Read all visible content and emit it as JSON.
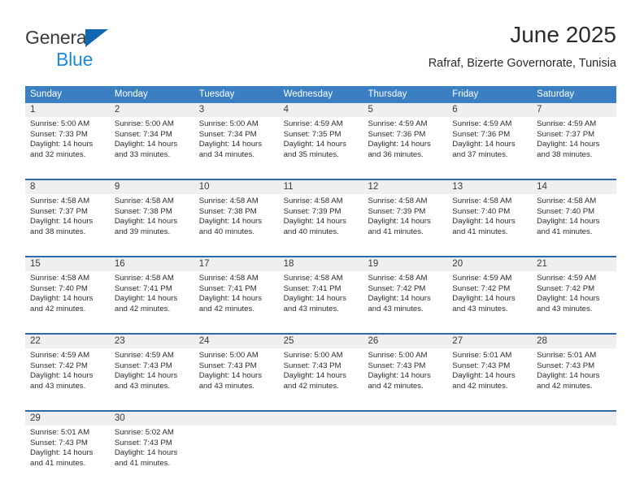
{
  "brand": {
    "name_part1": "General",
    "name_part2": "Blue",
    "logo_icon": "triangle-logo-icon",
    "accent_dark": "#1267b2",
    "accent_light": "#1e8ad6"
  },
  "header": {
    "title": "June 2025",
    "subtitle": "Rafraf, Bizerte Governorate, Tunisia"
  },
  "colors": {
    "header_row_bg": "#3a7fc1",
    "week_divider": "#2c6aa8",
    "daynum_strip_bg": "#efefef",
    "text": "#2d2d2d"
  },
  "calendar": {
    "weekdays": [
      "Sunday",
      "Monday",
      "Tuesday",
      "Wednesday",
      "Thursday",
      "Friday",
      "Saturday"
    ],
    "weeks": [
      [
        {
          "day": "1",
          "sunrise": "Sunrise: 5:00 AM",
          "sunset": "Sunset: 7:33 PM",
          "daylight_line1": "Daylight: 14 hours",
          "daylight_line2": "and 32 minutes."
        },
        {
          "day": "2",
          "sunrise": "Sunrise: 5:00 AM",
          "sunset": "Sunset: 7:34 PM",
          "daylight_line1": "Daylight: 14 hours",
          "daylight_line2": "and 33 minutes."
        },
        {
          "day": "3",
          "sunrise": "Sunrise: 5:00 AM",
          "sunset": "Sunset: 7:34 PM",
          "daylight_line1": "Daylight: 14 hours",
          "daylight_line2": "and 34 minutes."
        },
        {
          "day": "4",
          "sunrise": "Sunrise: 4:59 AM",
          "sunset": "Sunset: 7:35 PM",
          "daylight_line1": "Daylight: 14 hours",
          "daylight_line2": "and 35 minutes."
        },
        {
          "day": "5",
          "sunrise": "Sunrise: 4:59 AM",
          "sunset": "Sunset: 7:36 PM",
          "daylight_line1": "Daylight: 14 hours",
          "daylight_line2": "and 36 minutes."
        },
        {
          "day": "6",
          "sunrise": "Sunrise: 4:59 AM",
          "sunset": "Sunset: 7:36 PM",
          "daylight_line1": "Daylight: 14 hours",
          "daylight_line2": "and 37 minutes."
        },
        {
          "day": "7",
          "sunrise": "Sunrise: 4:59 AM",
          "sunset": "Sunset: 7:37 PM",
          "daylight_line1": "Daylight: 14 hours",
          "daylight_line2": "and 38 minutes."
        }
      ],
      [
        {
          "day": "8",
          "sunrise": "Sunrise: 4:58 AM",
          "sunset": "Sunset: 7:37 PM",
          "daylight_line1": "Daylight: 14 hours",
          "daylight_line2": "and 38 minutes."
        },
        {
          "day": "9",
          "sunrise": "Sunrise: 4:58 AM",
          "sunset": "Sunset: 7:38 PM",
          "daylight_line1": "Daylight: 14 hours",
          "daylight_line2": "and 39 minutes."
        },
        {
          "day": "10",
          "sunrise": "Sunrise: 4:58 AM",
          "sunset": "Sunset: 7:38 PM",
          "daylight_line1": "Daylight: 14 hours",
          "daylight_line2": "and 40 minutes."
        },
        {
          "day": "11",
          "sunrise": "Sunrise: 4:58 AM",
          "sunset": "Sunset: 7:39 PM",
          "daylight_line1": "Daylight: 14 hours",
          "daylight_line2": "and 40 minutes."
        },
        {
          "day": "12",
          "sunrise": "Sunrise: 4:58 AM",
          "sunset": "Sunset: 7:39 PM",
          "daylight_line1": "Daylight: 14 hours",
          "daylight_line2": "and 41 minutes."
        },
        {
          "day": "13",
          "sunrise": "Sunrise: 4:58 AM",
          "sunset": "Sunset: 7:40 PM",
          "daylight_line1": "Daylight: 14 hours",
          "daylight_line2": "and 41 minutes."
        },
        {
          "day": "14",
          "sunrise": "Sunrise: 4:58 AM",
          "sunset": "Sunset: 7:40 PM",
          "daylight_line1": "Daylight: 14 hours",
          "daylight_line2": "and 41 minutes."
        }
      ],
      [
        {
          "day": "15",
          "sunrise": "Sunrise: 4:58 AM",
          "sunset": "Sunset: 7:40 PM",
          "daylight_line1": "Daylight: 14 hours",
          "daylight_line2": "and 42 minutes."
        },
        {
          "day": "16",
          "sunrise": "Sunrise: 4:58 AM",
          "sunset": "Sunset: 7:41 PM",
          "daylight_line1": "Daylight: 14 hours",
          "daylight_line2": "and 42 minutes."
        },
        {
          "day": "17",
          "sunrise": "Sunrise: 4:58 AM",
          "sunset": "Sunset: 7:41 PM",
          "daylight_line1": "Daylight: 14 hours",
          "daylight_line2": "and 42 minutes."
        },
        {
          "day": "18",
          "sunrise": "Sunrise: 4:58 AM",
          "sunset": "Sunset: 7:41 PM",
          "daylight_line1": "Daylight: 14 hours",
          "daylight_line2": "and 43 minutes."
        },
        {
          "day": "19",
          "sunrise": "Sunrise: 4:58 AM",
          "sunset": "Sunset: 7:42 PM",
          "daylight_line1": "Daylight: 14 hours",
          "daylight_line2": "and 43 minutes."
        },
        {
          "day": "20",
          "sunrise": "Sunrise: 4:59 AM",
          "sunset": "Sunset: 7:42 PM",
          "daylight_line1": "Daylight: 14 hours",
          "daylight_line2": "and 43 minutes."
        },
        {
          "day": "21",
          "sunrise": "Sunrise: 4:59 AM",
          "sunset": "Sunset: 7:42 PM",
          "daylight_line1": "Daylight: 14 hours",
          "daylight_line2": "and 43 minutes."
        }
      ],
      [
        {
          "day": "22",
          "sunrise": "Sunrise: 4:59 AM",
          "sunset": "Sunset: 7:42 PM",
          "daylight_line1": "Daylight: 14 hours",
          "daylight_line2": "and 43 minutes."
        },
        {
          "day": "23",
          "sunrise": "Sunrise: 4:59 AM",
          "sunset": "Sunset: 7:43 PM",
          "daylight_line1": "Daylight: 14 hours",
          "daylight_line2": "and 43 minutes."
        },
        {
          "day": "24",
          "sunrise": "Sunrise: 5:00 AM",
          "sunset": "Sunset: 7:43 PM",
          "daylight_line1": "Daylight: 14 hours",
          "daylight_line2": "and 43 minutes."
        },
        {
          "day": "25",
          "sunrise": "Sunrise: 5:00 AM",
          "sunset": "Sunset: 7:43 PM",
          "daylight_line1": "Daylight: 14 hours",
          "daylight_line2": "and 42 minutes."
        },
        {
          "day": "26",
          "sunrise": "Sunrise: 5:00 AM",
          "sunset": "Sunset: 7:43 PM",
          "daylight_line1": "Daylight: 14 hours",
          "daylight_line2": "and 42 minutes."
        },
        {
          "day": "27",
          "sunrise": "Sunrise: 5:01 AM",
          "sunset": "Sunset: 7:43 PM",
          "daylight_line1": "Daylight: 14 hours",
          "daylight_line2": "and 42 minutes."
        },
        {
          "day": "28",
          "sunrise": "Sunrise: 5:01 AM",
          "sunset": "Sunset: 7:43 PM",
          "daylight_line1": "Daylight: 14 hours",
          "daylight_line2": "and 42 minutes."
        }
      ],
      [
        {
          "day": "29",
          "sunrise": "Sunrise: 5:01 AM",
          "sunset": "Sunset: 7:43 PM",
          "daylight_line1": "Daylight: 14 hours",
          "daylight_line2": "and 41 minutes."
        },
        {
          "day": "30",
          "sunrise": "Sunrise: 5:02 AM",
          "sunset": "Sunset: 7:43 PM",
          "daylight_line1": "Daylight: 14 hours",
          "daylight_line2": "and 41 minutes."
        },
        {
          "day": "",
          "sunrise": "",
          "sunset": "",
          "daylight_line1": "",
          "daylight_line2": ""
        },
        {
          "day": "",
          "sunrise": "",
          "sunset": "",
          "daylight_line1": "",
          "daylight_line2": ""
        },
        {
          "day": "",
          "sunrise": "",
          "sunset": "",
          "daylight_line1": "",
          "daylight_line2": ""
        },
        {
          "day": "",
          "sunrise": "",
          "sunset": "",
          "daylight_line1": "",
          "daylight_line2": ""
        },
        {
          "day": "",
          "sunrise": "",
          "sunset": "",
          "daylight_line1": "",
          "daylight_line2": ""
        }
      ]
    ]
  }
}
